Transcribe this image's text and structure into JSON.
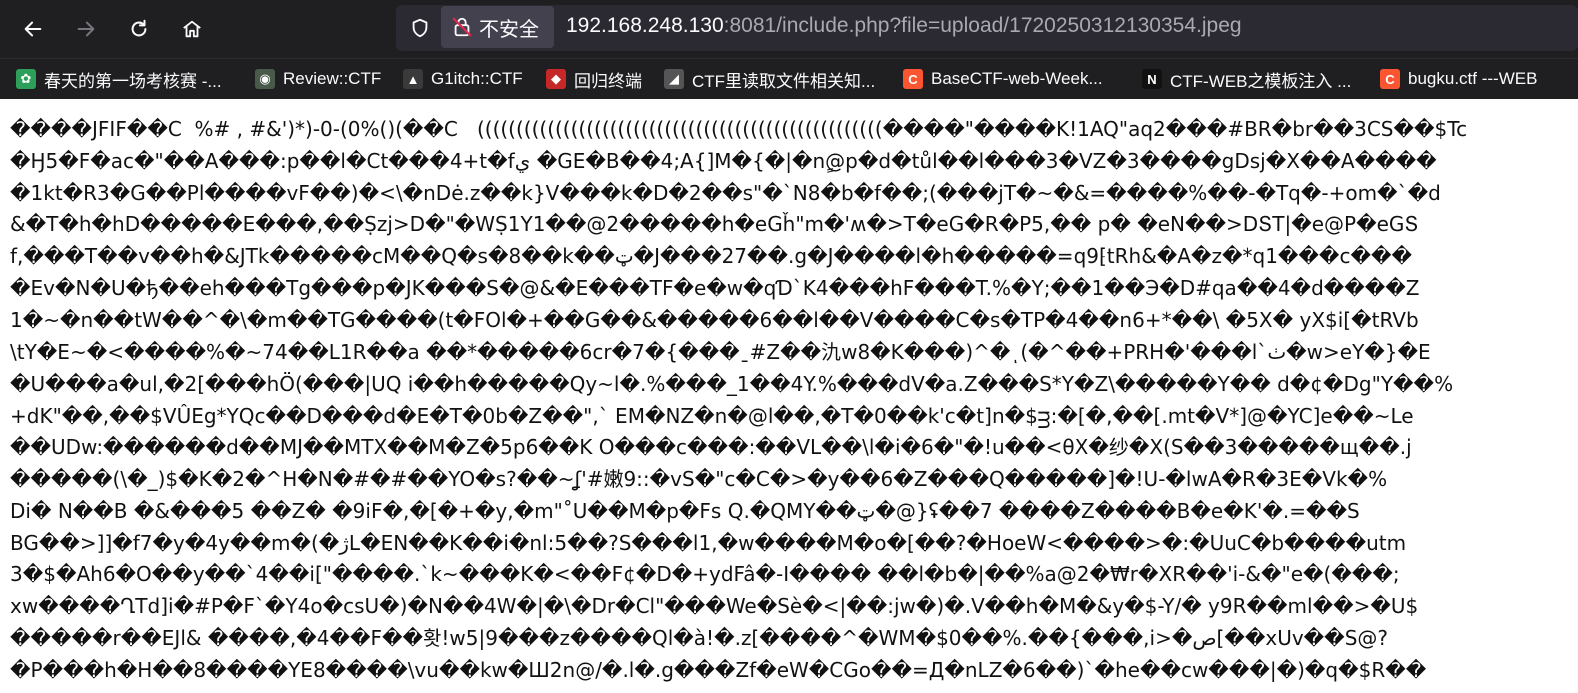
{
  "toolbar": {
    "back_icon": "arrow-left-icon",
    "forward_icon": "arrow-right-icon",
    "reload_icon": "reload-icon",
    "home_icon": "home-icon",
    "insecure_label": "不安全",
    "url_host": "192.168.248.130",
    "url_rest": ":8081/include.php?file=upload/1720250312130354.jpeg"
  },
  "bookmarks": [
    {
      "icon": "bookmark-favicon",
      "color": "#2e9e5b",
      "label": "春天的第一场考核赛 -..."
    },
    {
      "icon": "bookmark-favicon",
      "color": "#4a5a4a",
      "label": "Review::CTF"
    },
    {
      "icon": "bookmark-favicon",
      "color": "#3a3a3a",
      "label": "G1itch::CTF"
    },
    {
      "icon": "bookmark-favicon",
      "color": "#c62828",
      "label": "回归终端"
    },
    {
      "icon": "bookmark-favicon",
      "color": "#555555",
      "label": "CTF里读取文件相关知..."
    },
    {
      "icon": "csdn-icon",
      "color": "#fc5531",
      "label": "BaseCTF-web-Week..."
    },
    {
      "icon": "n-icon",
      "color": "#111111",
      "label": "CTF-WEB之模板注入 ..."
    },
    {
      "icon": "csdn-icon",
      "color": "#fc5531",
      "label": "bugku.ctf ---WEB"
    }
  ],
  "content": {
    "lines": [
      "����JFIF��C  %# , #&')*)-0-(0%()(��C   ((((((((((((((((((((((((((((((((((((((((((((((((((((����\"����K!1AQ\"aq2���#BR�br��3CS��$Tc",
      "�Ӈ5�F�ac�\"��A���:p��l�Ct���4+t�fي �GE�B��4;A{]M�{�|�n@ٍp�d�tůl��l���3�VZ�3����gDsj�X��A����",
      "�1kt�R3�G��Pl����vF��)�<\\�nDė.z��k}V���k�D�2��s\"�`N8�b�f��;(���jT�~�&=����%��-�Tq�-+om�`�d",
      "&�T�h�hD�����E���,��Ṣzj>D�\"�WṢ1Y1��@2�����h�eGȟ\"m�'ʍ�>T�eG�R�P5,�� p� �eN��>DՏT|�e@P�eGՏ",
      "f,���T��v��h�&JTk�����cM��Q�s�8��k��ټ�J���27��.g�J����l�h�����=q9⁅tRh&�A�z�*q1���c���",
      "�Ev�N�U�ђ��eh���Tg���p�JK���S�@&�E���TF�e�w�qƊ`K4���hF���T.%�Y;��1��Э�D#qa��4�d����Z",
      "1�~�n��tW��^�\\�m��TG����(t�FOl�+��G��&�����6��l��V����C�s�TP�4��n6+*��\\ �5X� yX$i[�tRVb",
      "\\tY�E~�<����%�~74��L1R��a ��*�����6cr�7�{���ˍ#Z��氿w8�K���)^�ͺ(�^��+PRH�'���l`ٺ�w>eY�}�E",
      "�U���a�ul,�2[���hÖ(���|UQ i��h�����Qy~l�.%���_1��4Y.%���dV�a.Z���S*Y�Z\\�����Y�� d�¢�Dg\"Y��%",
      "+dK\"��,��$VÛEg*YQc��D���d�E�T�0b�Z��\",` EM�NZ�n�@l��,�T�0��k'c�t]n�$ᴟ:�[�,��[.mt�V*]@�YC]e��~Le",
      "��UDw:������d��MJ��MTX��M�Z�5p6��K O���c���:��VL��\\l�i�6�\"�!u��<θX�纱�X(S��3�����щ��.j",
      "�����(\\�_)$�K�2�^H�N�#�#��YO�s?��~ʆ'#嫩9::�vS�\"c�C�>�y��6�Z���Q�����]�!U-�lwA�R�3E�Vk�%",
      "Di� N��B �&���5 ��Z� �9iF�,�[�+�y,�m\"˚U��M�p�Fs Q.�QMY��ټ�@}ʢ��7 ����Z����B�e�K'�.=��S",
      "BG��>]]�f7�y�4y��m�(�ژL�EN��K��i�nl:5��?S���l1,�w����M�o�[��?�HoeW<����>�:�UuC�b����utm",
      "3�$�Ah6�O��y��`4��i[\"����.`k~���K�<��F¢�D�+ydFâ�-I���� ��l�b�|��%a@2�₩r�XR��'i-&�\"e�(���;",
      "xw����ՂTd]i�#P�F`�Y4o�csU�)�N��4W�|�\\�Dr�Cl\"���We�Sè�<|��:jw�)�.V��h�M�&y�$-Y/� y9R��ml��>�U$",
      "�����r��EJl& ����,�4��F��홧!w5|9���z����Ql�à!�.z[����^�WM�$0��%.��{���,i>�ص[��xUv��S@?",
      "�P���h�H��8����YE8����\\vu��kw�Ш2n@/�.l�.g���Zf�eW�CGo��=Д�nLZ�6��)`�he��cw���|�)�q�$R��"
    ]
  }
}
